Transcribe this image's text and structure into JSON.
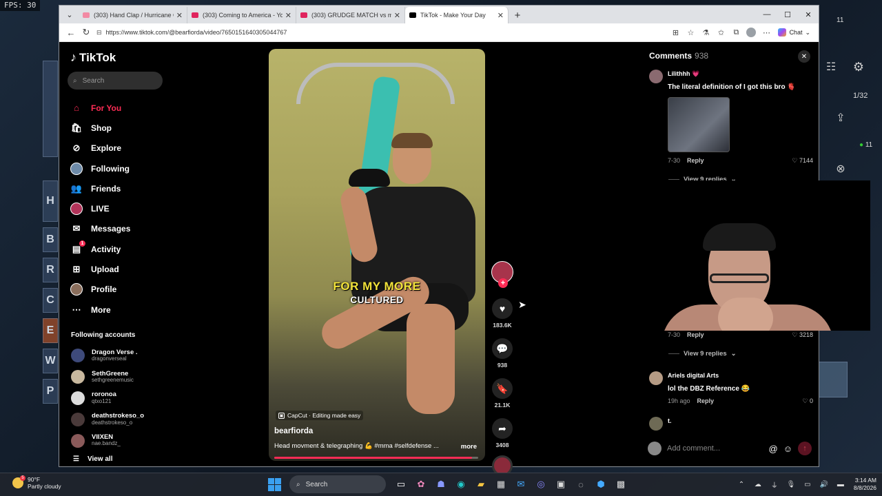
{
  "overlay": {
    "fps_label": "FPS:",
    "fps_value": "30"
  },
  "background_tiles": [
    "H",
    "B",
    "R",
    "C",
    "E",
    "W",
    "P"
  ],
  "background_hud": {
    "counter": "1/32",
    "status_count": "11",
    "top_right_count": "11"
  },
  "browser": {
    "tabs": [
      {
        "title": "(303) Hand Clap / Hurricane Chris",
        "icon": "pink"
      },
      {
        "title": "(303) Coming to America - YouTube",
        "icon": "youtube"
      },
      {
        "title": "(303) GRUDGE MATCH vs my Best",
        "icon": "youtube"
      },
      {
        "title": "TikTok - Make Your Day",
        "icon": "tiktok",
        "active": true
      }
    ],
    "url": "https://www.tiktok.com/@bearfiorda/video/7650151640305044767",
    "chat_label": "Chat"
  },
  "tiktok": {
    "logo_text": "TikTok",
    "search_placeholder": "Search",
    "nav": [
      {
        "label": "For You",
        "icon": "home-icon",
        "active": true
      },
      {
        "label": "Shop",
        "icon": "shop-icon"
      },
      {
        "label": "Explore",
        "icon": "compass-icon"
      },
      {
        "label": "Following",
        "icon": "following-avatar"
      },
      {
        "label": "Friends",
        "icon": "friends-icon"
      },
      {
        "label": "LIVE",
        "icon": "live-avatar"
      },
      {
        "label": "Messages",
        "icon": "messages-icon"
      },
      {
        "label": "Activity",
        "icon": "activity-icon",
        "badge": "1"
      },
      {
        "label": "Upload",
        "icon": "upload-icon"
      },
      {
        "label": "Profile",
        "icon": "profile-avatar"
      },
      {
        "label": "More",
        "icon": "more-icon"
      }
    ],
    "following_title": "Following accounts",
    "following_accounts": [
      {
        "name": "Dragon Verse .",
        "handle": "dragonverseal"
      },
      {
        "name": "SethGreene",
        "handle": "sethgreenemusic"
      },
      {
        "name": "roronoa",
        "handle": "qtxo121"
      },
      {
        "name": "deathstrokeso_o",
        "handle": "deathstrokeso_o"
      },
      {
        "name": "VIIXEN",
        "handle": "nae.bandz_"
      }
    ],
    "view_all": "View all",
    "video": {
      "caption_line1": "FOR MY MORE",
      "caption_line2": "CULTURED",
      "capcut": "CapCut · Editing made easy",
      "author": "bearfiorda",
      "description": "Head movment & telegraphing 💪 #mma #selfdefense ...",
      "more": "more",
      "progress": 0.97
    },
    "actions": {
      "likes": "183.6K",
      "comments": "938",
      "saves": "21.1K",
      "shares": "3408"
    },
    "comments_panel": {
      "title": "Comments",
      "count": "938",
      "comments": [
        {
          "user": "Lilithhh 💗",
          "text": "The literal definition of I got this bro 🫀",
          "date": "7-30",
          "reply": "Reply",
          "likes": "7144",
          "view_replies": "View 9 replies"
        },
        {
          "date": "7-30",
          "reply": "Reply",
          "likes": "3218",
          "view_replies": "View 9 replies"
        },
        {
          "user": "Ariels digital Arts",
          "text": "lol the DBZ Reference 😂",
          "date": "19h ago",
          "reply": "Reply",
          "likes": "0"
        },
        {
          "user": "t."
        }
      ],
      "add_placeholder": "Add comment..."
    }
  },
  "taskbar": {
    "weather_temp": "90°F",
    "weather_desc": "Partly cloudy",
    "weather_badge": "5",
    "search_label": "Search",
    "time": "3:14 AM",
    "date": "8/8/2026"
  }
}
